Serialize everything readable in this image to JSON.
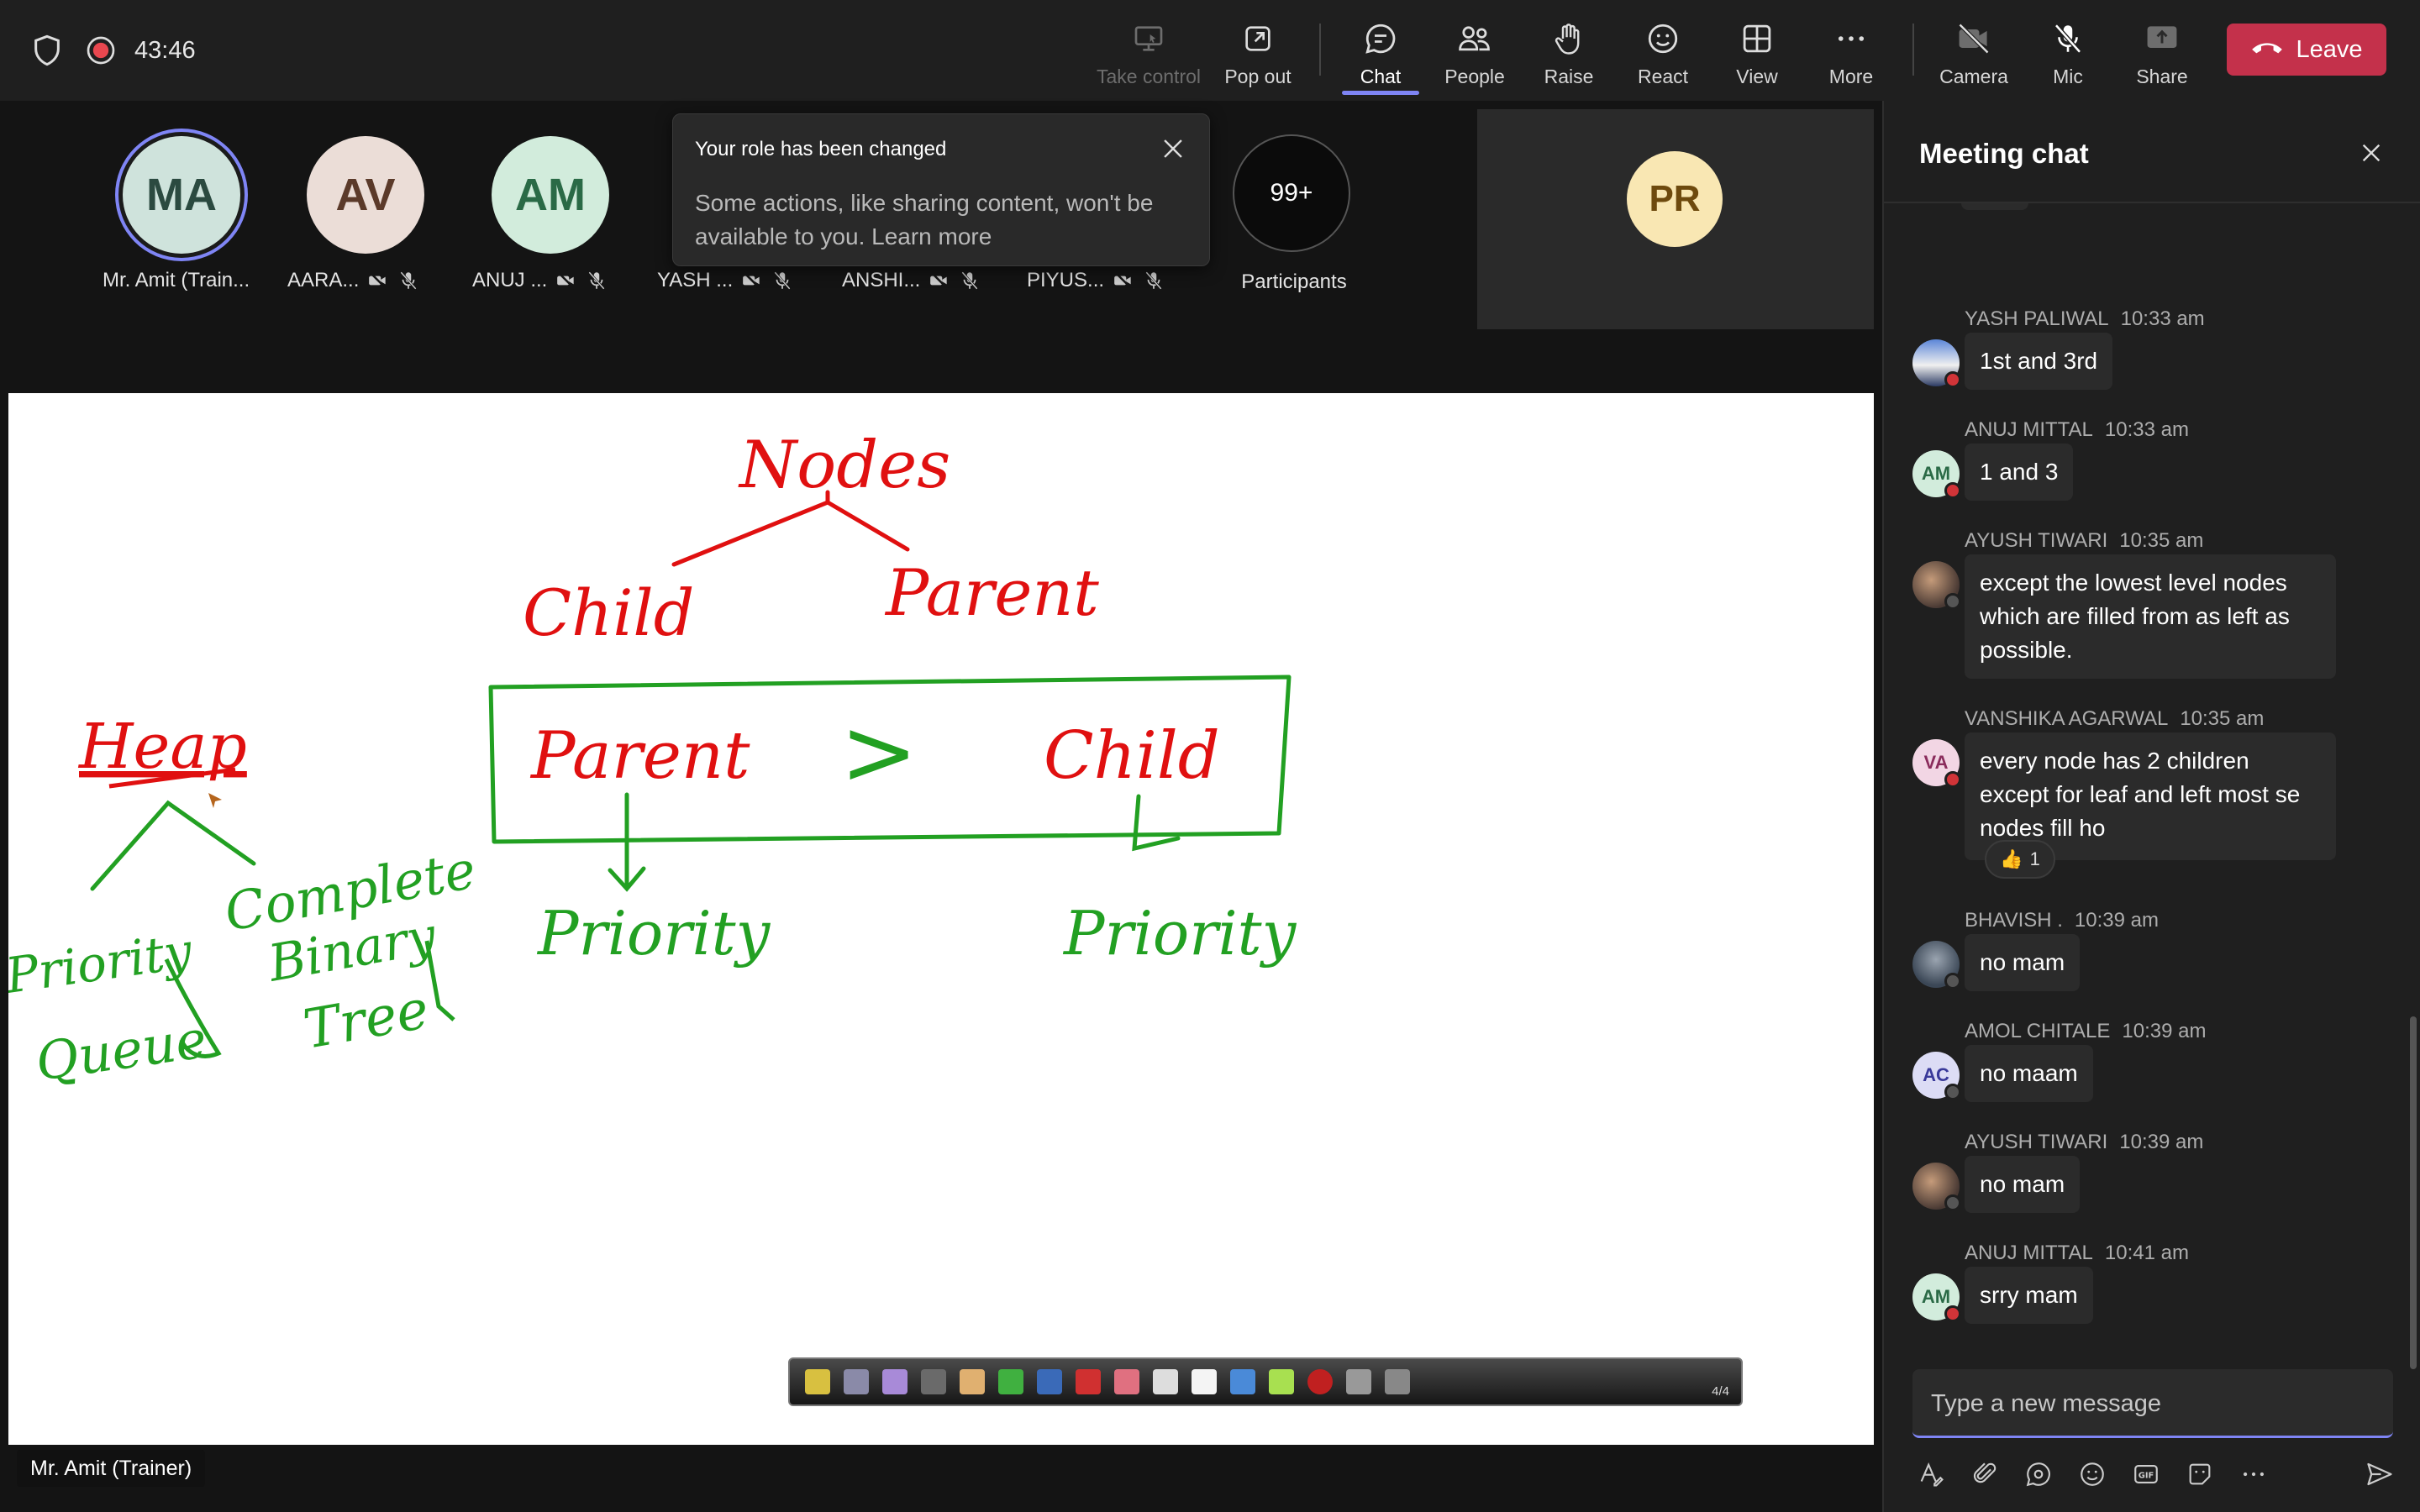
{
  "topbar": {
    "timer": "43:46",
    "buttons": [
      {
        "label": "Take control",
        "icon": "take-control-icon"
      },
      {
        "label": "Pop out",
        "icon": "pop-out-icon"
      },
      {
        "label": "Chat",
        "icon": "chat-icon"
      },
      {
        "label": "People",
        "icon": "people-icon"
      },
      {
        "label": "Raise",
        "icon": "hand-icon"
      },
      {
        "label": "React",
        "icon": "smiley-icon"
      },
      {
        "label": "View",
        "icon": "grid-icon"
      },
      {
        "label": "More",
        "icon": "more-icon"
      },
      {
        "label": "Camera",
        "icon": "camera-off-icon"
      },
      {
        "label": "Mic",
        "icon": "mic-off-icon"
      },
      {
        "label": "Share",
        "icon": "share-icon"
      }
    ],
    "leave_label": "Leave",
    "accent": "#7f85f5",
    "leave_color": "#c4314b"
  },
  "participants": [
    {
      "initials": "MA",
      "name": "Mr. Amit (Train...",
      "bg": "#cfe3dc",
      "fg": "#2b4a40"
    },
    {
      "initials": "AV",
      "name": "AARA...",
      "bg": "#ebddd7",
      "fg": "#5b3a2a"
    },
    {
      "initials": "AM",
      "name": "ANUJ ...",
      "bg": "#d2ecdc",
      "fg": "#2a6a46"
    },
    {
      "initials": "",
      "name": "YASH ...",
      "bg": "",
      "fg": ""
    },
    {
      "initials": "",
      "name": "ANSHI...",
      "bg": "",
      "fg": ""
    },
    {
      "initials": "",
      "name": "PIYUS...",
      "bg": "",
      "fg": ""
    }
  ],
  "toast": {
    "title": "Your role has been changed",
    "body": "Some actions, like sharing content, won't be available to you. Learn more"
  },
  "participants_count": "99+",
  "participants_label": "Participants",
  "tile": {
    "initials": "PR"
  },
  "presenter_name": "Mr. Amit (Trainer)",
  "whiteboard": {
    "page": "4/4",
    "texts": {
      "nodes": "Nodes",
      "child_top": "Child",
      "parent_top": "Parent",
      "heap": "Heap",
      "parent_box": "Parent",
      "gt": ">",
      "child_box": "Child",
      "priority_left": "Priority",
      "priority_right": "Priority",
      "priority_queue_1": "Priority",
      "priority_queue_2": "Queue",
      "cbt_1": "Complete",
      "cbt_2": "Binary",
      "cbt_3": "Tree"
    }
  },
  "chat": {
    "title": "Meeting chat",
    "messages": [
      {
        "author": "YASH PALIWAL",
        "time": "10:33 am",
        "text": "1st and 3rd",
        "avatar": "photo"
      },
      {
        "author": "ANUJ MITTAL",
        "time": "10:33 am",
        "text": "1 and 3",
        "avatar": "AM"
      },
      {
        "author": "AYUSH TIWARI",
        "time": "10:35 am",
        "text": "except the lowest level nodes which are filled from as left as possible.",
        "avatar": "photo"
      },
      {
        "author": "VANSHIKA AGARWAL",
        "time": "10:35 am",
        "text": "every node has 2 children except for leaf and left most se nodes fill ho",
        "avatar": "VA",
        "reaction": "1"
      },
      {
        "author": "BHAVISH .",
        "time": "10:39 am",
        "text": "no mam",
        "avatar": "photo"
      },
      {
        "author": "AMOL CHITALE",
        "time": "10:39 am",
        "text": "no maam",
        "avatar": "AC"
      },
      {
        "author": "AYUSH TIWARI",
        "time": "10:39 am",
        "text": "no mam",
        "avatar": "photo"
      },
      {
        "author": "ANUJ MITTAL",
        "time": "10:41 am",
        "text": "srry mam",
        "avatar": "AM"
      }
    ],
    "compose_placeholder": "Type a new message"
  }
}
